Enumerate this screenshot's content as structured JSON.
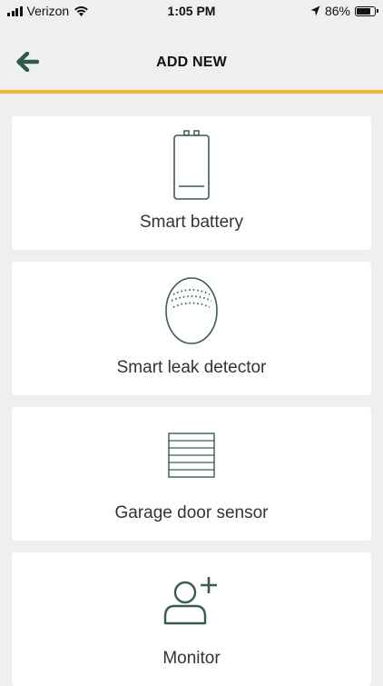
{
  "status_bar": {
    "carrier": "Verizon",
    "time": "1:05 PM",
    "battery_percent": "86%",
    "battery_level": 0.86,
    "icons": [
      "signal-icon",
      "wifi-icon",
      "location-arrow-icon",
      "battery-icon"
    ]
  },
  "nav": {
    "title": "ADD NEW",
    "back_icon": "back-arrow-icon",
    "accent_color": "#f5b233",
    "icon_color": "#2f5a50"
  },
  "devices": [
    {
      "label": "Smart battery",
      "icon": "battery-icon"
    },
    {
      "label": "Smart leak detector",
      "icon": "leak-detector-icon"
    },
    {
      "label": "Garage door sensor",
      "icon": "garage-door-icon"
    },
    {
      "label": "Monitor",
      "icon": "add-person-icon"
    }
  ]
}
